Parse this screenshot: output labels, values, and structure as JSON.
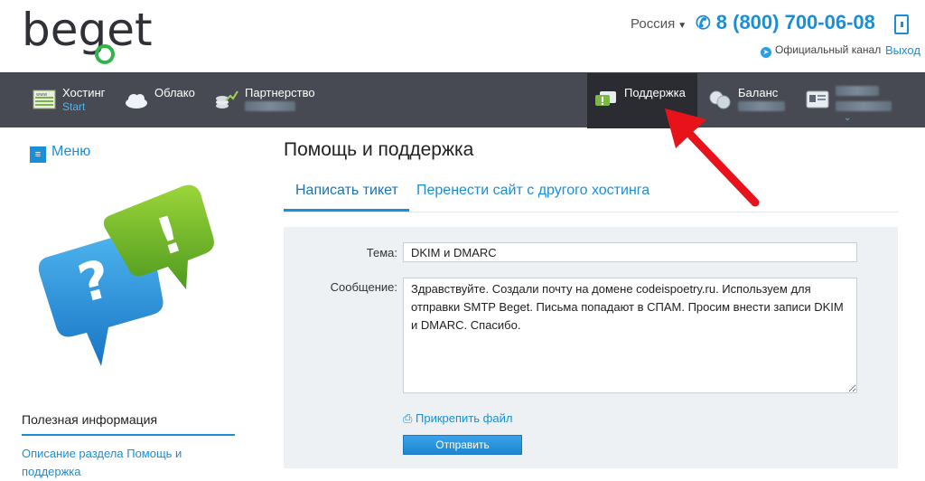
{
  "header": {
    "logo_text": "beget",
    "region": "Россия",
    "phone": "8 (800) 700-06-08",
    "channel": "Официальный канал",
    "exit": "Выход"
  },
  "nav": {
    "items": [
      {
        "label": "Хостинг",
        "sub": "Start"
      },
      {
        "label": "Облако",
        "sub": ""
      },
      {
        "label": "Партнерство",
        "sub": ""
      },
      {
        "label": "Поддержка",
        "sub": ""
      },
      {
        "label": "Баланс",
        "sub": ""
      }
    ],
    "active": "Поддержка",
    "colors": {
      "bar": "#474a52",
      "active": "#2a2c31",
      "accent": "#53b2ec"
    }
  },
  "sidebar": {
    "menu_label": "Меню",
    "useful_heading": "Полезная информация",
    "link": "Описание раздела Помощь и поддержка"
  },
  "main": {
    "title": "Помощь и поддержка",
    "tabs": [
      {
        "label": "Написать тикет",
        "active": true
      },
      {
        "label": "Перенести сайт с другого хостинга",
        "active": false
      }
    ],
    "form": {
      "subject_label": "Тема:",
      "subject_value": "DKIM и DMARC",
      "message_label": "Сообщение:",
      "message_value": "Здравствуйте. Создали почту на домене codeispoetry.ru. Используем для отправки SMTP Beget. Письма попадают в СПАМ. Просим внести записи DKIM и DMARC. Спасибо.",
      "attach_label": "Прикрепить файл",
      "submit_label": "Отправить"
    }
  },
  "colors": {
    "accent": "#1a8fd6",
    "annotation_arrow": "#e8121b"
  }
}
